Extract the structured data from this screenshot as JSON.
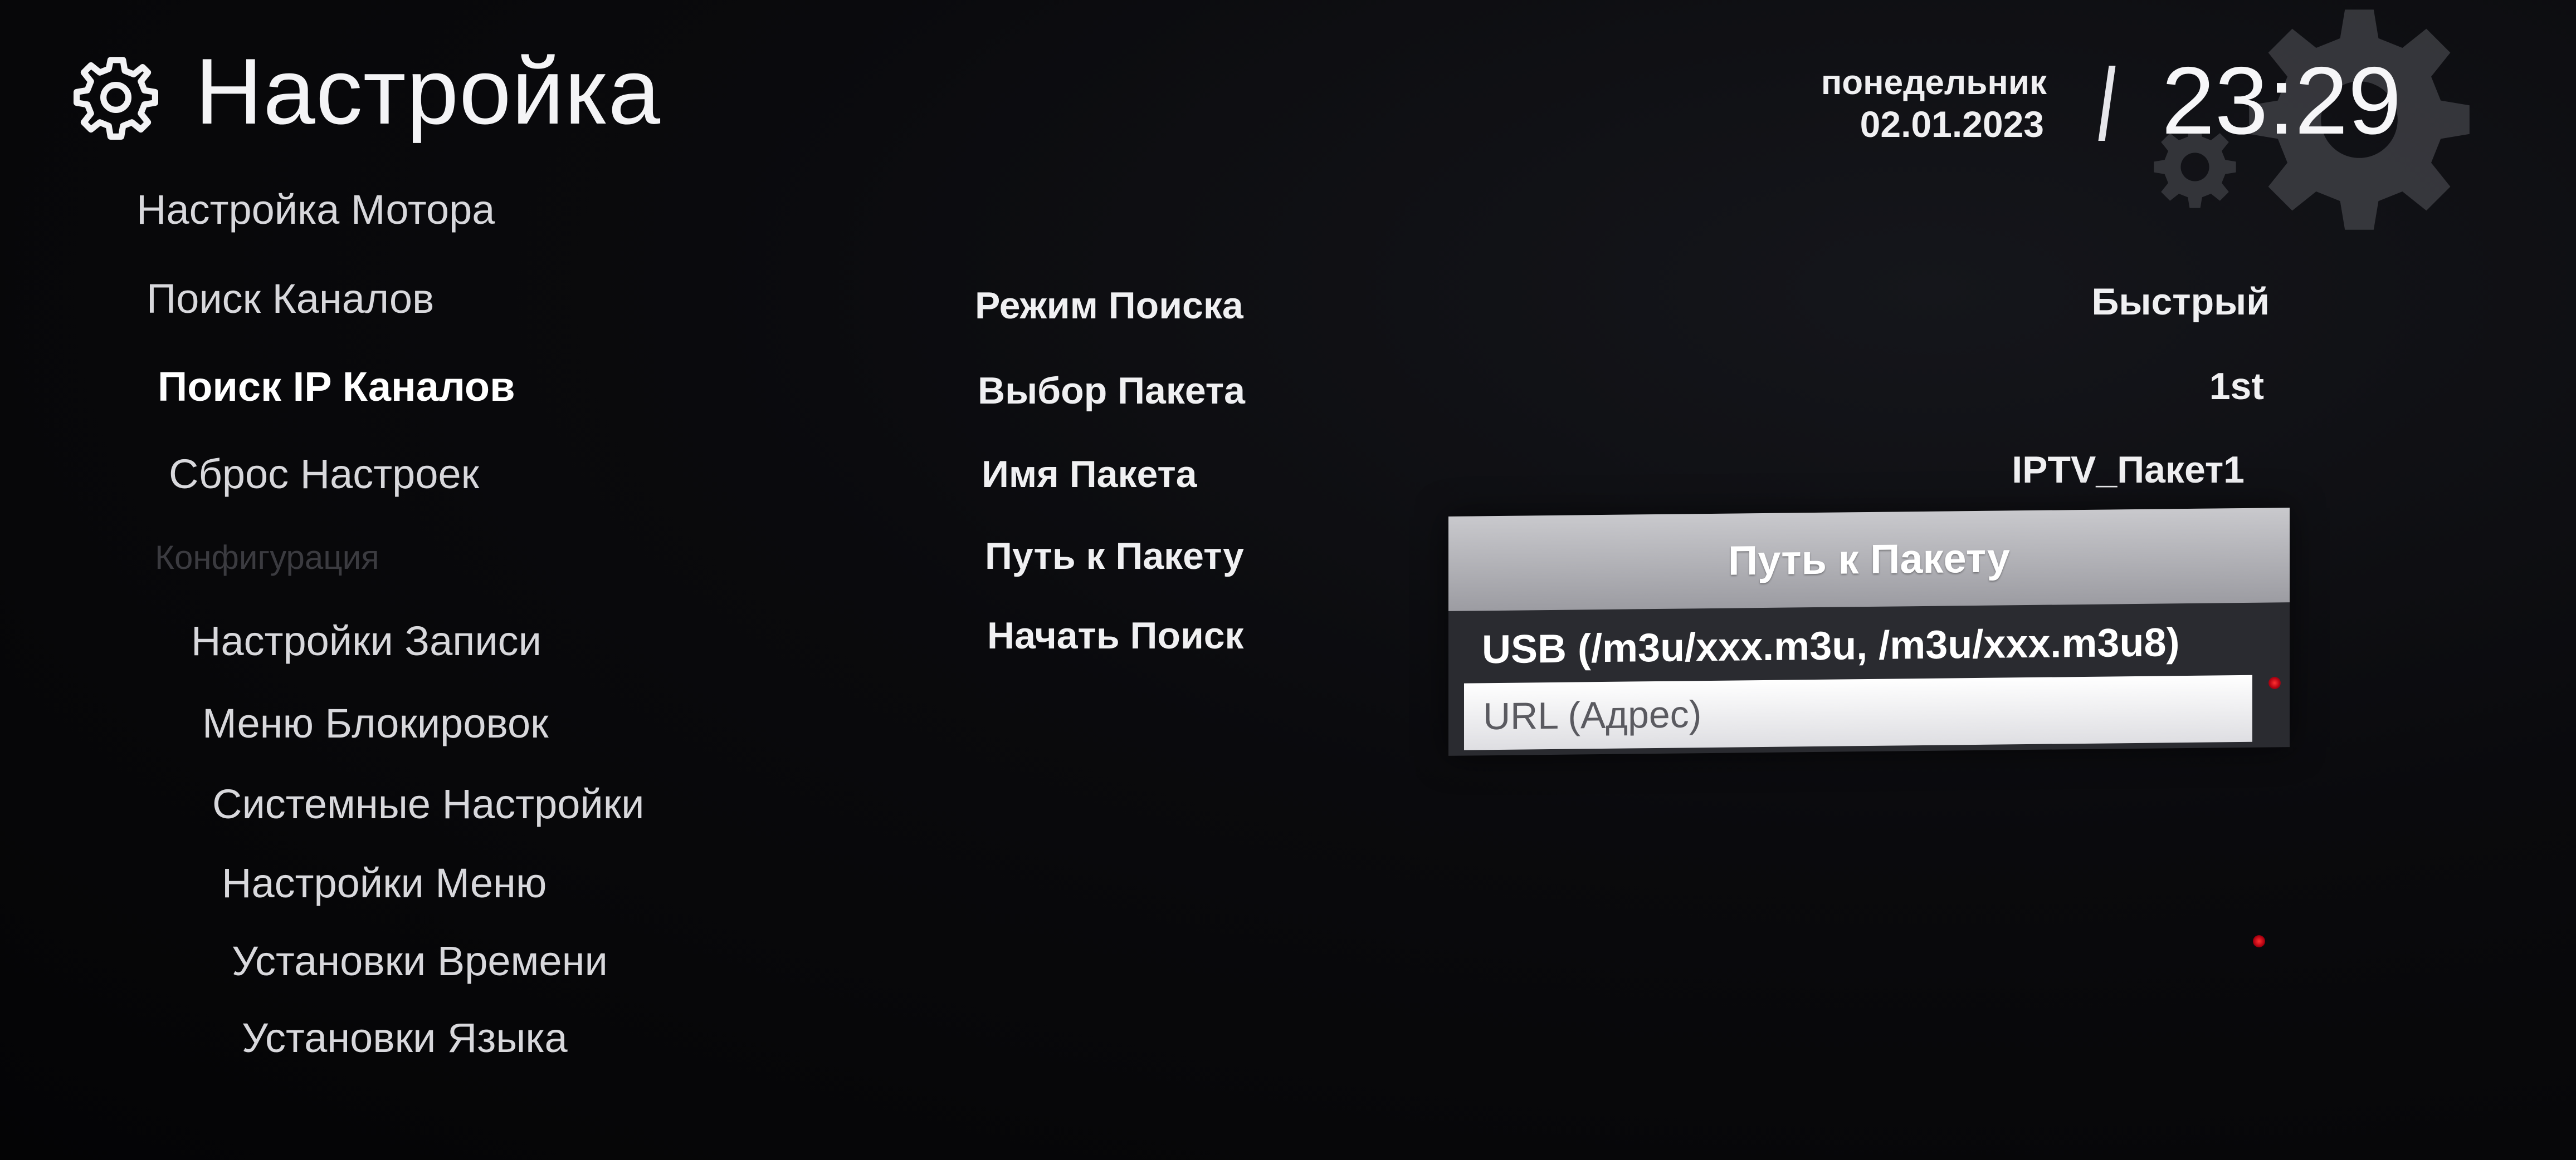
{
  "header": {
    "title": "Настройка",
    "title_icon": "gear-icon",
    "day": "понедельник",
    "date": "02.01.2023",
    "time": "23:29"
  },
  "sidebar": {
    "items": [
      {
        "label": "Настройка Мотора",
        "state": "normal"
      },
      {
        "label": "Поиск Каналов",
        "state": "normal"
      },
      {
        "label": "Поиск IP Каналов",
        "state": "active"
      },
      {
        "label": "Сброс Настроек",
        "state": "normal"
      },
      {
        "label": "Конфигурация",
        "state": "disabled"
      },
      {
        "label": "Настройки Записи",
        "state": "normal"
      },
      {
        "label": "Меню Блокировок",
        "state": "normal"
      },
      {
        "label": "Системные Настройки",
        "state": "normal"
      },
      {
        "label": "Настройки Меню",
        "state": "normal"
      },
      {
        "label": "Установки Времени",
        "state": "normal"
      },
      {
        "label": "Установки Языка",
        "state": "normal"
      }
    ]
  },
  "options": {
    "rows": [
      {
        "label": "Режим Поиска",
        "value": "Быстрый"
      },
      {
        "label": "Выбор Пакета",
        "value": "1st"
      },
      {
        "label": "Имя Пакета",
        "value": "IPTV_Пакет1"
      },
      {
        "label": "Путь к Пакету",
        "value": ""
      },
      {
        "label": "Начать Поиск",
        "value": ""
      }
    ]
  },
  "popup": {
    "title": "Путь к Пакету",
    "options": [
      "USB (/m3u/xxx.m3u, /m3u/xxx.m3u8)",
      "URL (Адрес)"
    ],
    "selected_index": 1
  },
  "colors": {
    "background": "#050507",
    "text": "#f0f0f2",
    "disabled": "#3b3b40",
    "popup_bg": "#2a2b30",
    "popup_header": "#b5b5ba",
    "highlight": "#ffffff"
  }
}
